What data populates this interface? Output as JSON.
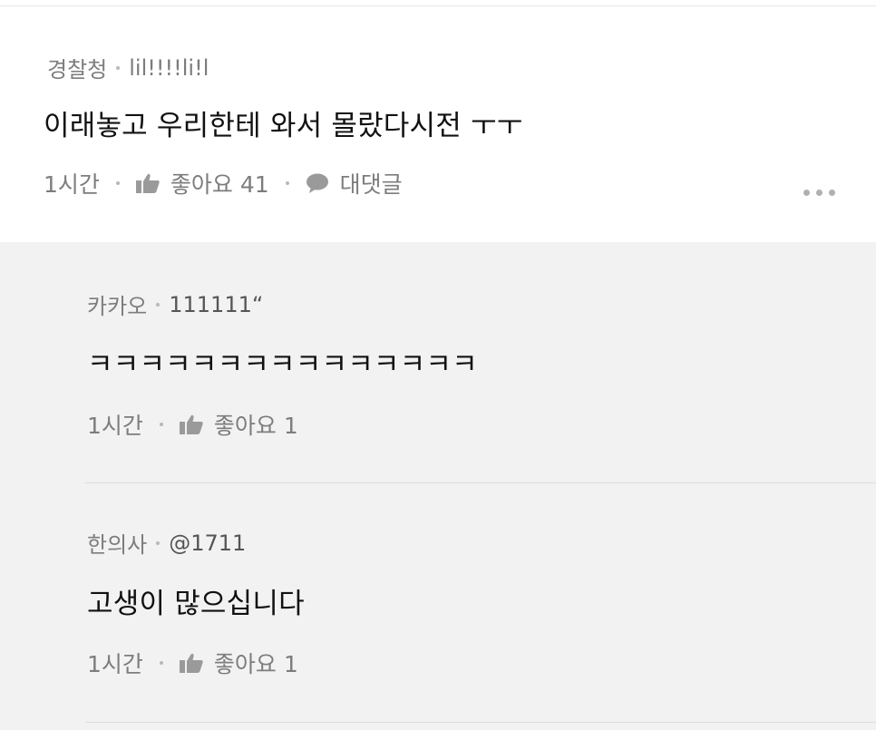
{
  "main_comment": {
    "author": "경찰청",
    "handle": "lil!!!!li!l",
    "text": "이래놓고 우리한테 와서 몰랐다시전 ㅜㅜ",
    "time": "1시간",
    "like_label": "좋아요 41",
    "reply_label": "대댓글"
  },
  "replies": [
    {
      "author": "카카오",
      "handle": "111111“",
      "text": "ㅋㅋㅋㅋㅋㅋㅋㅋㅋㅋㅋㅋㅋㅋㅋ",
      "time": "1시간",
      "like_label": "좋아요 1"
    },
    {
      "author": "한의사",
      "handle": "@1711",
      "text": "고생이 많으십니다",
      "time": "1시간",
      "like_label": "좋아요 1"
    }
  ],
  "icons": {
    "like": "thumbs-up-icon",
    "reply": "speech-bubble-icon",
    "more": "more-horizontal-icon"
  },
  "colors": {
    "reply_background": "#f2f2f2",
    "meta_text": "#7d7d7d",
    "body_text": "#111111"
  }
}
